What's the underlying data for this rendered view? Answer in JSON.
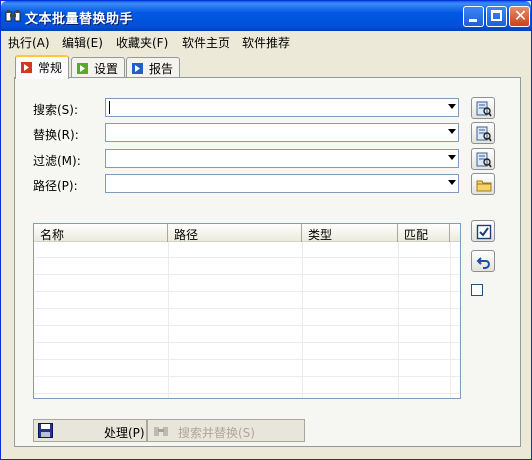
{
  "window": {
    "title": "文本批量替换助手"
  },
  "menu": [
    "执行(A)",
    "编辑(E)",
    "收藏夹(F)",
    "软件主页",
    "软件推荐"
  ],
  "tabs": [
    {
      "label": "常规",
      "active": true,
      "icon": "arrow-red-icon"
    },
    {
      "label": "设置",
      "active": false,
      "icon": "arrow-green-icon"
    },
    {
      "label": "报告",
      "active": false,
      "icon": "arrow-blue-icon"
    }
  ],
  "form": {
    "search": {
      "label": "搜索(S):",
      "value": ""
    },
    "replace": {
      "label": "替换(R):",
      "value": ""
    },
    "filter": {
      "label": "过滤(M):",
      "value": ""
    },
    "path": {
      "label": "路径(P):",
      "value": ""
    }
  },
  "list": {
    "columns": [
      "名称",
      "路径",
      "类型",
      "匹配"
    ],
    "rows": []
  },
  "buttons": {
    "process": "处理(P)",
    "search_replace": "搜索并替换(S)"
  },
  "colors": {
    "titlebar": "#0058E3",
    "face": "#ECE9D8",
    "border": "#7F9DB9"
  }
}
